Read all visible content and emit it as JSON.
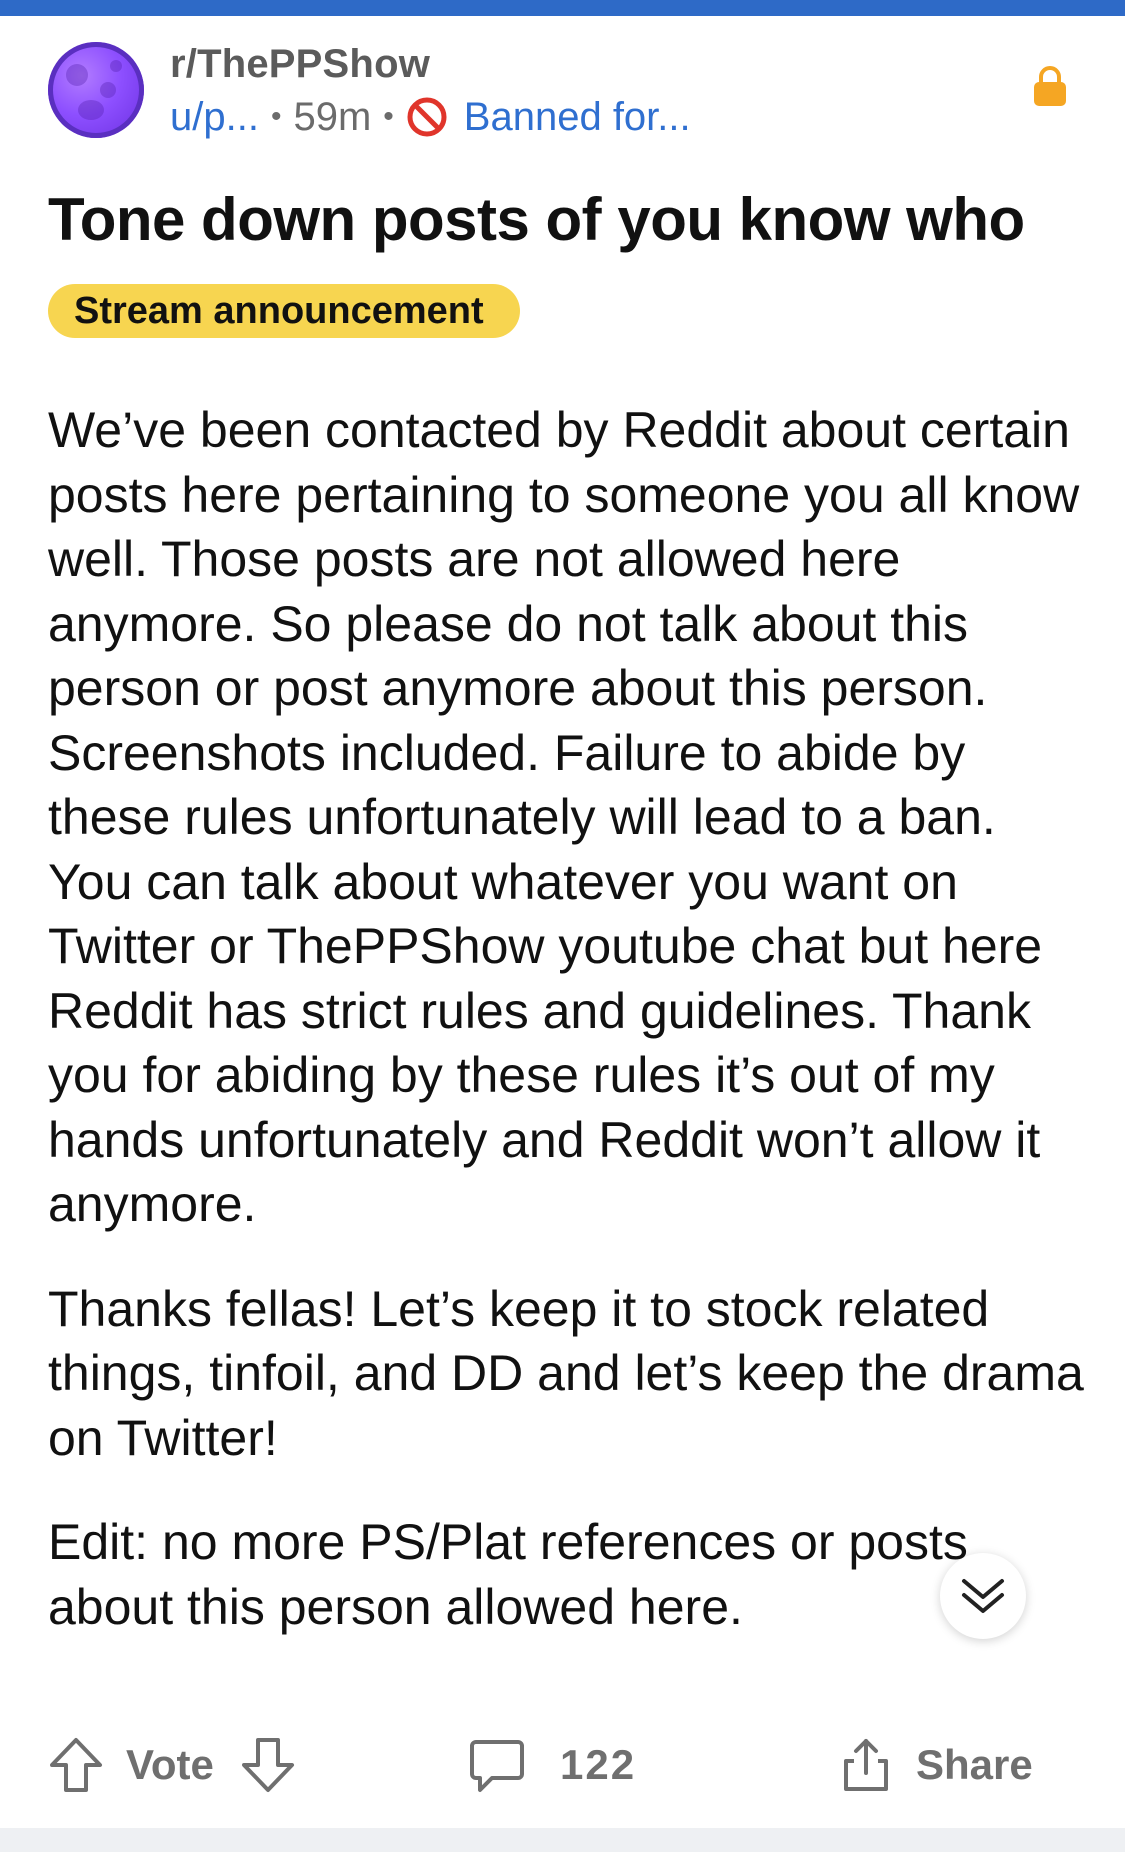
{
  "header": {
    "subreddit": "r/ThePPShow",
    "user": "u/p...",
    "time": "59m",
    "status": "Banned for..."
  },
  "post": {
    "title": "Tone down posts of you know who",
    "flair": "Stream announcement",
    "paragraphs": [
      "We’ve been contacted by Reddit about certain posts here pertaining to someone you all know well. Those posts are not allowed here anymore. So please do not talk about this person or post anymore about this person. Screenshots included. Failure to abide by these rules unfortunately will lead to a ban. You can talk about whatever you want on Twitter or ThePPShow youtube chat but here Reddit has strict rules and guidelines. Thank you for abiding by these rules it’s out of my hands unfortunately and Reddit won’t allow it anymore.",
      "Thanks fellas! Let’s keep it to stock related things, tinfoil, and DD and let’s keep the drama on Twitter!",
      "Edit: no more PS/Plat references or posts about this person allowed here."
    ]
  },
  "actions": {
    "vote_label": "Vote",
    "comment_count": "122",
    "share_label": "Share"
  },
  "icons": {
    "upvote": "arrow-up-icon",
    "downvote": "arrow-down-icon",
    "comment": "speech-bubble-icon",
    "share": "share-upload-icon",
    "lock": "lock-icon",
    "ban": "ban-icon",
    "scroll": "double-chevron-down-icon"
  },
  "colors": {
    "accent_blue": "#2f6fd0",
    "top_bar": "#2e6ac7",
    "flair_bg": "#f7d550",
    "lock": "#f5a623",
    "ban_red": "#e0352b"
  }
}
